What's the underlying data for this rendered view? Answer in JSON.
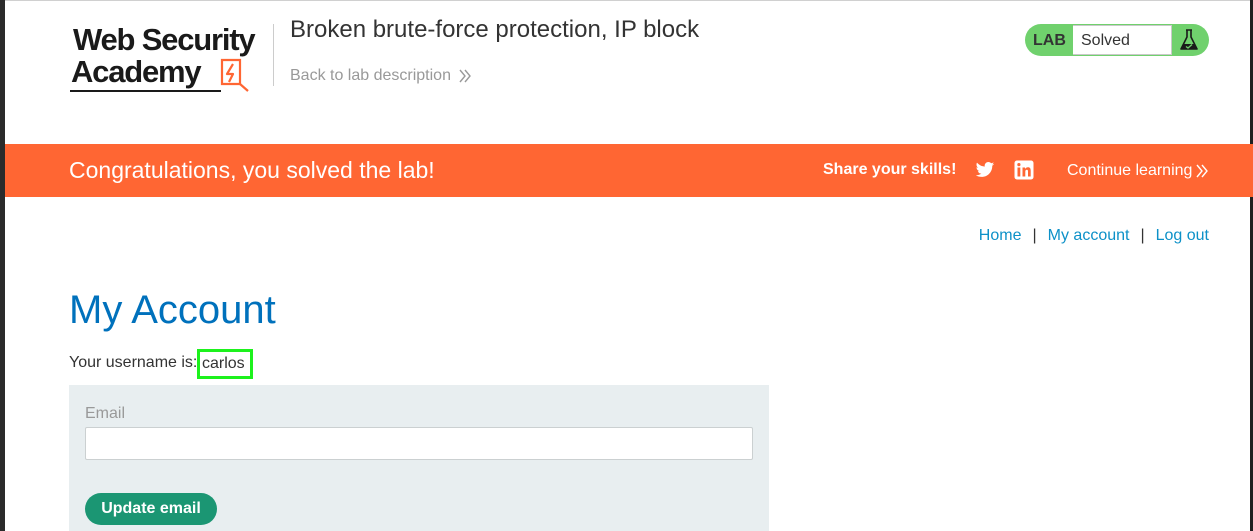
{
  "header": {
    "logo": {
      "line1": "Web Security",
      "line2": "Academy"
    },
    "lab_title": "Broken brute-force protection, IP block",
    "back_link": "Back to lab description",
    "lab_status": {
      "badge": "LAB",
      "status": "Solved"
    }
  },
  "banner": {
    "message": "Congratulations, you solved the lab!",
    "share_label": "Share your skills!",
    "continue_link": "Continue learning"
  },
  "nav": {
    "home": "Home",
    "separator": "|",
    "my_account": "My account",
    "log_out": "Log out"
  },
  "main": {
    "title": "My Account",
    "username_label": "Your username is:",
    "username_value": "carlos",
    "email_label": "Email",
    "email_value": "",
    "update_button": "Update email"
  },
  "colors": {
    "banner": "#ff6633",
    "title": "#0071bc",
    "link": "#0d91c8",
    "status_green": "#70d16d",
    "button": "#1b9673",
    "highlight": "#1df21d"
  },
  "icons": {
    "logo": "lightning-bolt-icon",
    "back": "double-chevron-right-icon",
    "flask": "flask-icon",
    "twitter": "twitter-icon",
    "linkedin": "linkedin-icon"
  }
}
